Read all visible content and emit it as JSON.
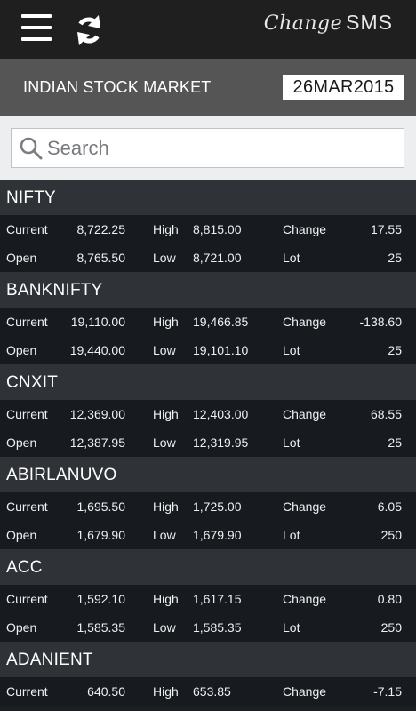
{
  "app": {
    "brand_script": "Change",
    "brand_sms": "SMS"
  },
  "header": {
    "title": "INDIAN STOCK MARKET",
    "date": "26MAR2015"
  },
  "search": {
    "placeholder": "Search",
    "value": ""
  },
  "labels": {
    "current": "Current",
    "open": "Open",
    "high": "High",
    "low": "Low",
    "change": "Change",
    "lot": "Lot"
  },
  "stocks": [
    {
      "name": "NIFTY",
      "current": "8,722.25",
      "high": "8,815.00",
      "change": "17.55",
      "open": "8,765.50",
      "low": "8,721.00",
      "lot": "25"
    },
    {
      "name": "BANKNIFTY",
      "current": "19,110.00",
      "high": "19,466.85",
      "change": "-138.60",
      "open": "19,440.00",
      "low": "19,101.10",
      "lot": "25"
    },
    {
      "name": "CNXIT",
      "current": "12,369.00",
      "high": "12,403.00",
      "change": "68.55",
      "open": "12,387.95",
      "low": "12,319.95",
      "lot": "25"
    },
    {
      "name": "ABIRLANUVO",
      "current": "1,695.50",
      "high": "1,725.00",
      "change": "6.05",
      "open": "1,679.90",
      "low": "1,679.90",
      "lot": "250"
    },
    {
      "name": "ACC",
      "current": "1,592.10",
      "high": "1,617.15",
      "change": "0.80",
      "open": "1,585.35",
      "low": "1,585.35",
      "lot": "250"
    },
    {
      "name": "ADANIENT",
      "current": "640.50",
      "high": "653.85",
      "change": "-7.15"
    }
  ],
  "icons": {
    "menu": "hamburger-menu-icon",
    "refresh": "refresh-icon",
    "search": "search-icon"
  },
  "colors": {
    "topbar": "#1f1f1f",
    "header_bar": "#555556",
    "stock_header": "#2f3236",
    "stock_row": "#171a1f"
  }
}
